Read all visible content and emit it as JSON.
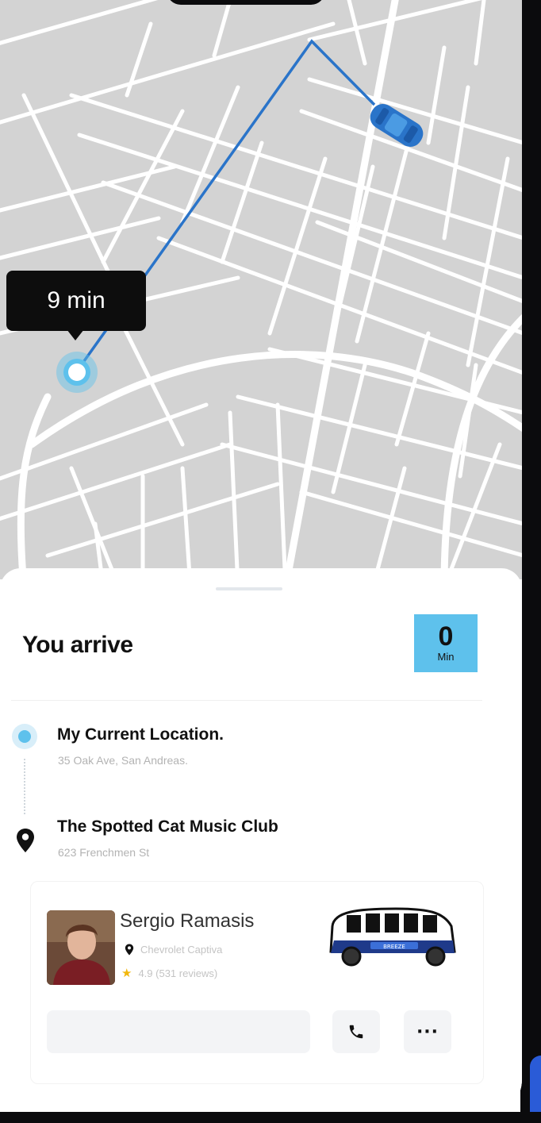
{
  "map": {
    "eta_label": "9 min",
    "route_color": "#2a74c9",
    "pickup_color": "#5ec1ec",
    "car_color": "#2a74c9"
  },
  "trip": {
    "title": "You arrive",
    "eta_value": "0",
    "eta_unit": "Min",
    "accent_color": "#5ec1ec"
  },
  "stops": [
    {
      "title": "My Current Location.",
      "address": "35 Oak Ave, San Andreas.",
      "icon": "current-location-icon"
    },
    {
      "title": "The Spotted Cat Music Club",
      "address": "623 Frenchmen St",
      "icon": "map-pin-icon"
    }
  ],
  "driver": {
    "name": "Sergio Ramasis",
    "car": "Chevrolet Captiva",
    "rating": "4.9 (531 reviews)",
    "vehicle_brand": "BREEZE"
  },
  "actions": {
    "message_placeholder": "",
    "call_icon": "phone-icon",
    "more_label": "···"
  }
}
